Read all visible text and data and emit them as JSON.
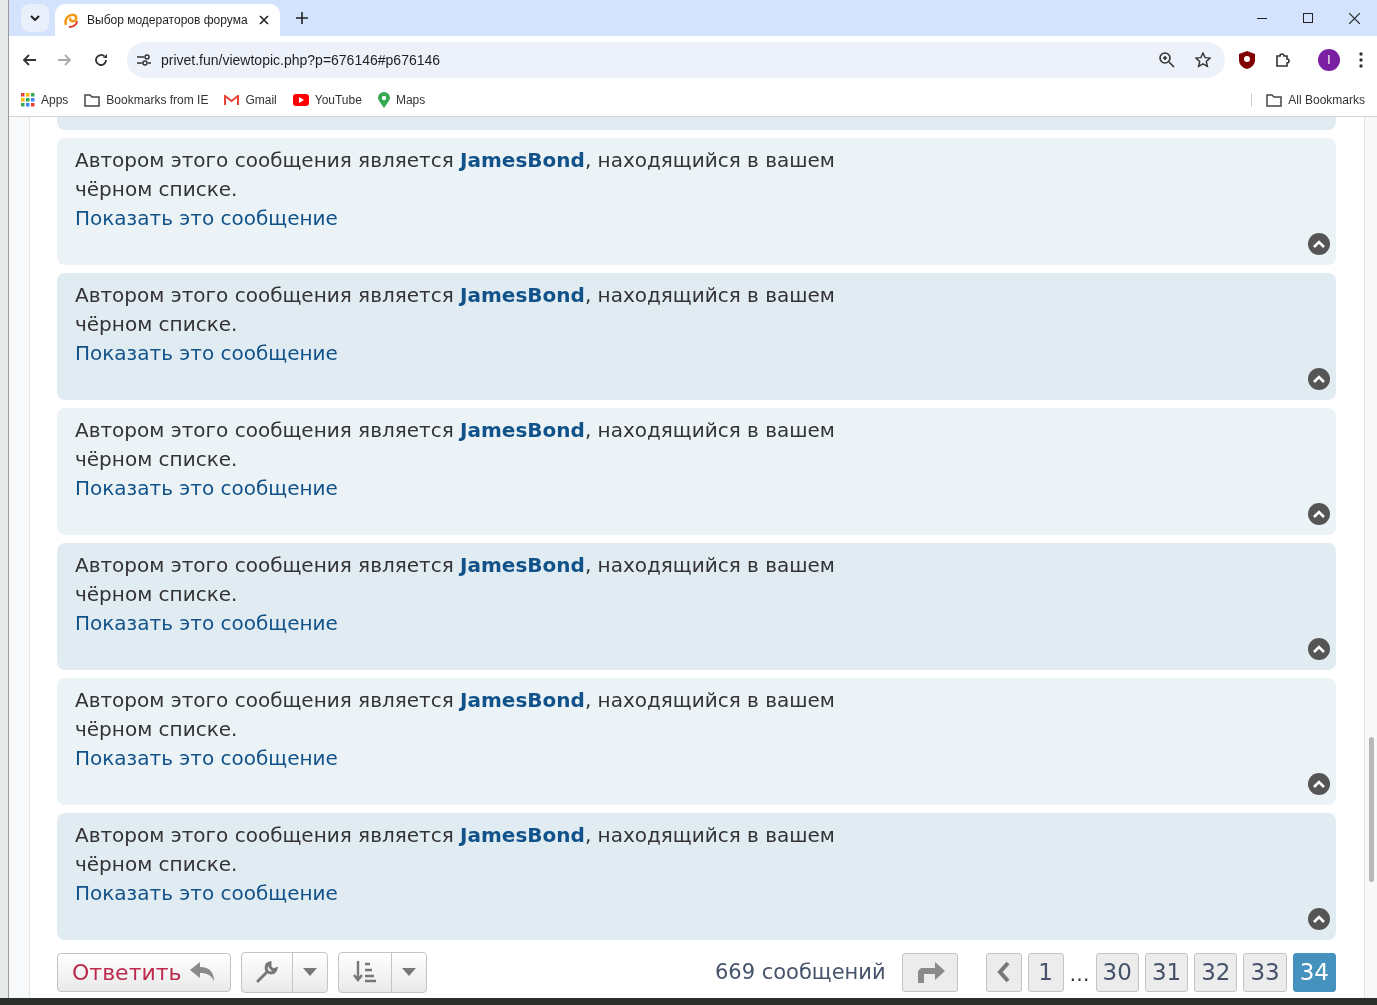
{
  "browser": {
    "tab": {
      "title": "Выбор модераторов форума"
    },
    "url": "privet.fun/viewtopic.php?p=676146#p676146",
    "bookmarks": [
      "Apps",
      "Bookmarks from IE",
      "Gmail",
      "YouTube",
      "Maps"
    ],
    "all_bookmarks": "All Bookmarks",
    "profile_initial": "I"
  },
  "posts": [
    {
      "notice": "Автором этого сообщения является **JamesBond**, находящийся в вашем чёрном списке.",
      "link": "Показать это сообщение"
    },
    {
      "notice": "Автором этого сообщения является **JamesBond**, находящийся в вашем чёрном списке.",
      "link": "Показать это сообщение"
    },
    {
      "notice": "Автором этого сообщения является **JamesBond**, находящийся в вашем чёрном списке.",
      "link": "Показать это сообщение"
    },
    {
      "notice": "Автором этого сообщения является **JamesBond**, находящийся в вашем чёрном списке.",
      "link": "Показать это сообщение"
    },
    {
      "notice": "Автором этого сообщения является **JamesBond**, находящийся в вашем чёрном списке.",
      "link": "Показать это сообщение"
    },
    {
      "notice": "Автором этого сообщения является **JamesBond**, находящийся в вашем чёрном списке.",
      "link": "Показать это сообщение"
    }
  ],
  "action_bar": {
    "reply": "Ответить",
    "post_count": "669 сообщений",
    "pages": [
      {
        "label": "1",
        "selected": false
      },
      {
        "label": "…",
        "kind": "ellipsis"
      },
      {
        "label": "30",
        "selected": false
      },
      {
        "label": "31",
        "selected": false
      },
      {
        "label": "32",
        "selected": false
      },
      {
        "label": "33",
        "selected": false
      },
      {
        "label": "34",
        "selected": true
      }
    ]
  }
}
